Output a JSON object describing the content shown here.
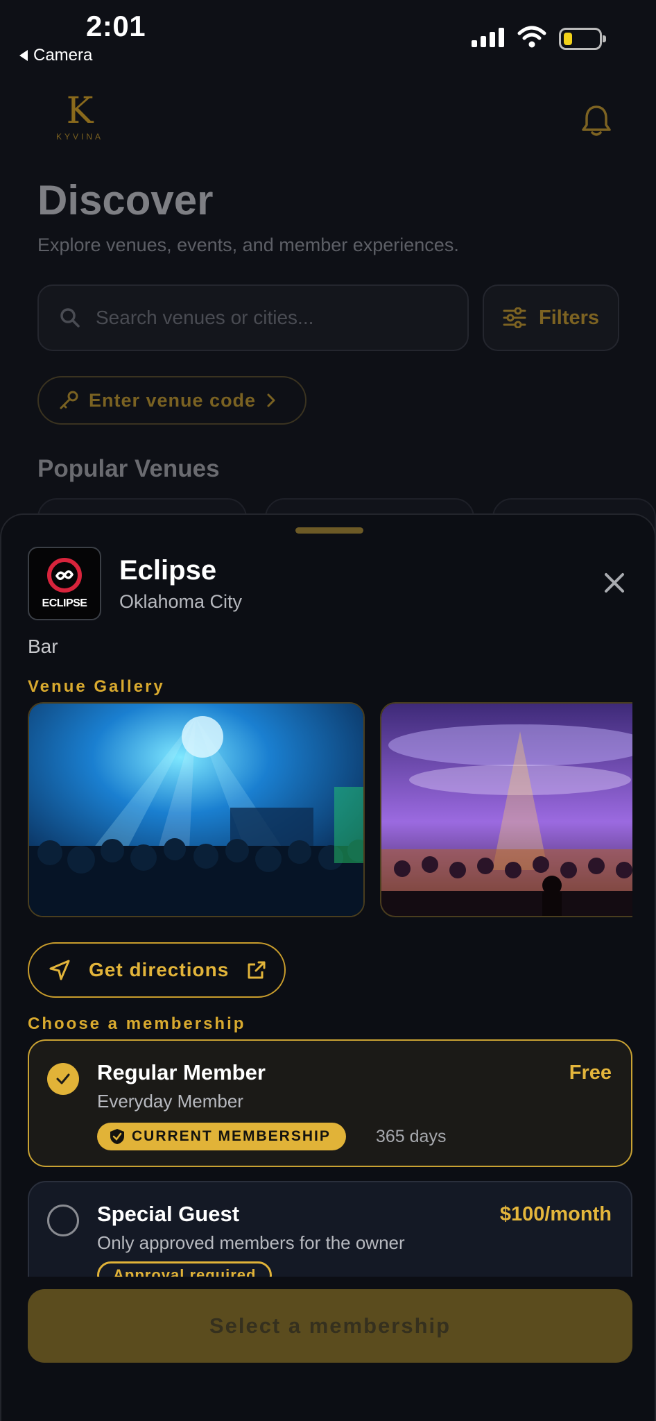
{
  "status_bar": {
    "time": "2:01",
    "back_app": "Camera"
  },
  "header": {
    "logo_letter": "K",
    "brand": "KYVINA"
  },
  "discover": {
    "title": "Discover",
    "subtitle": "Explore venues, events, and member experiences.",
    "search_placeholder": "Search venues or cities...",
    "filters_label": "Filters",
    "venue_code_label": "Enter venue code",
    "popular_title": "Popular Venues"
  },
  "sheet": {
    "venue": {
      "name": "Eclipse",
      "city": "Oklahoma City",
      "type": "Bar",
      "avatar_text": "ECLIPSE"
    },
    "gallery_label": "Venue Gallery",
    "directions_label": "Get directions",
    "membership_label": "Choose a membership",
    "memberships": [
      {
        "name": "Regular Member",
        "description": "Everyday Member",
        "price": "Free",
        "badge": "CURRENT MEMBERSHIP",
        "duration": "365 days",
        "selected": true
      },
      {
        "name": "Special Guest",
        "description": "Only approved members for the owner",
        "price": "$100/month",
        "badge": "Approval required",
        "selected": false
      }
    ],
    "select_button": "Select a membership"
  },
  "colors": {
    "accent": "#e1b338",
    "background": "#0c0e14",
    "card_selected": "#1b1a17"
  }
}
